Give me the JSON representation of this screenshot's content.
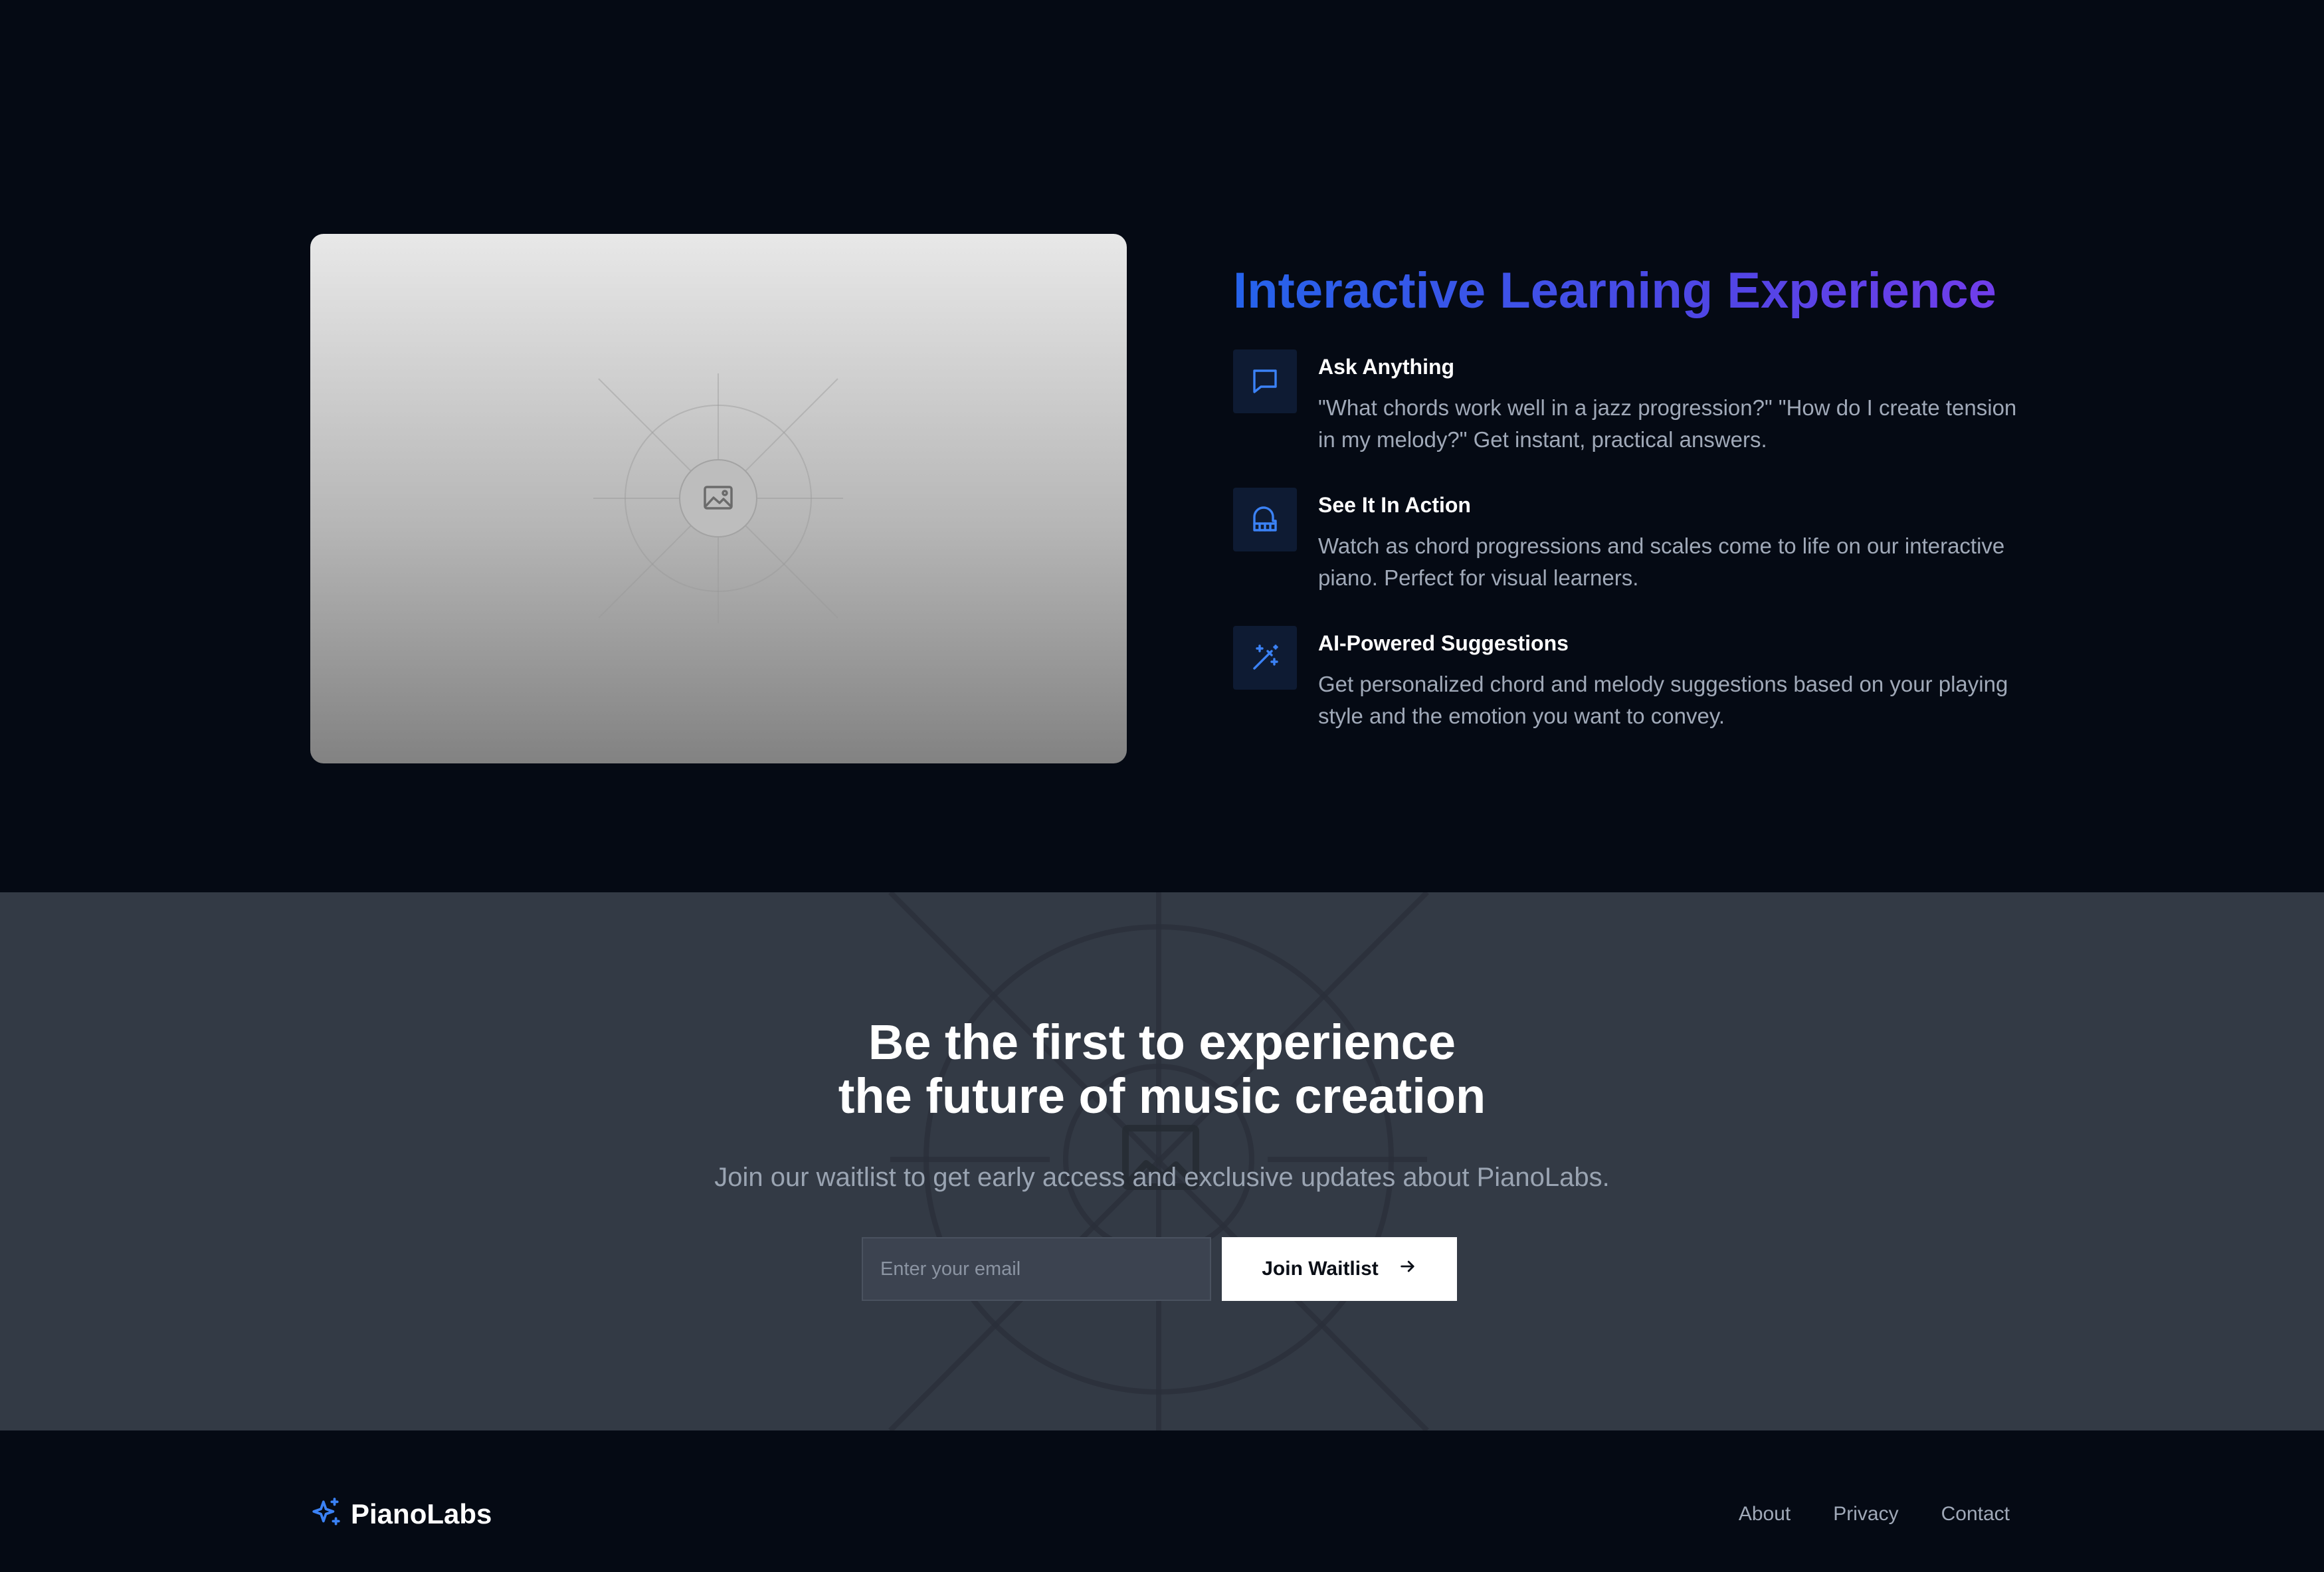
{
  "features": {
    "title": "Interactive Learning Experience",
    "items": [
      {
        "title": "Ask Anything",
        "description": "\"What chords work well in a jazz progression?\" \"How do I create tension in my melody?\" Get instant, practical answers.",
        "icon": "chat-bubble-icon"
      },
      {
        "title": "See It In Action",
        "description": "Watch as chord progressions and scales come to life on our interactive piano. Perfect for visual learners.",
        "icon": "piano-icon"
      },
      {
        "title": "AI-Powered Suggestions",
        "description": "Get personalized chord and melody suggestions based on your playing style and the emotion you want to convey.",
        "icon": "magic-wand-icon"
      }
    ],
    "media_icon": "image-placeholder-icon"
  },
  "waitlist": {
    "title_line1": "Be the first to experience",
    "title_line2": "the future of music creation",
    "subtitle": "Join our waitlist to get early access and exclusive updates about PianoLabs.",
    "email_placeholder": "Enter your email",
    "email_value": "",
    "button_label": "Join Waitlist",
    "button_icon": "arrow-right-icon"
  },
  "footer": {
    "brand": "PianoLabs",
    "brand_icon": "sparkle-icon",
    "links": [
      "About",
      "Privacy",
      "Contact"
    ]
  },
  "colors": {
    "background": "#050a14",
    "waitlist_background": "#333a45",
    "accent_blue": "#2563eb",
    "accent_purple": "#7c3aed",
    "icon_blue": "#3b82f6",
    "text_muted": "#a0a9b8"
  }
}
